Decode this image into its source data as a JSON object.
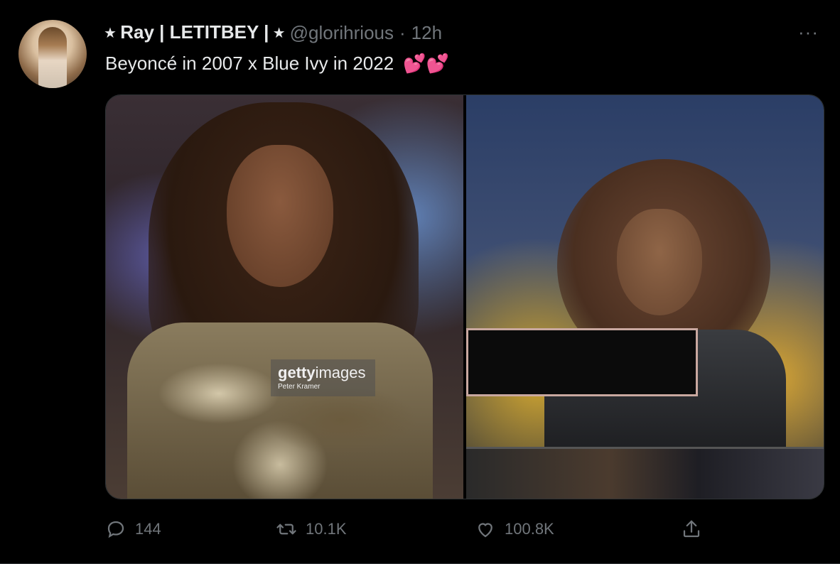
{
  "tweet": {
    "display_name": "⭑ Ray | LETITBEY | ⭑",
    "handle": "@glorihrious",
    "separator": "·",
    "time": "12h",
    "more_label": "···",
    "text": "Beyoncé in 2007 x Blue Ivy in 2022",
    "emoji": "💕💕"
  },
  "media": {
    "left_photo": {
      "watermark_brand": "getty",
      "watermark_brand_suffix": "images",
      "watermark_credit": "Peter Kramer"
    }
  },
  "actions": {
    "reply_count": "144",
    "retweet_count": "10.1K",
    "like_count": "100.8K"
  },
  "icons": {
    "reply": "reply-icon",
    "retweet": "retweet-icon",
    "like": "heart-icon",
    "share": "share-icon"
  },
  "colors": {
    "background": "#000000",
    "primary_text": "#e7e9ea",
    "secondary_text": "#71767b",
    "emoji_heart": "#f91880"
  }
}
